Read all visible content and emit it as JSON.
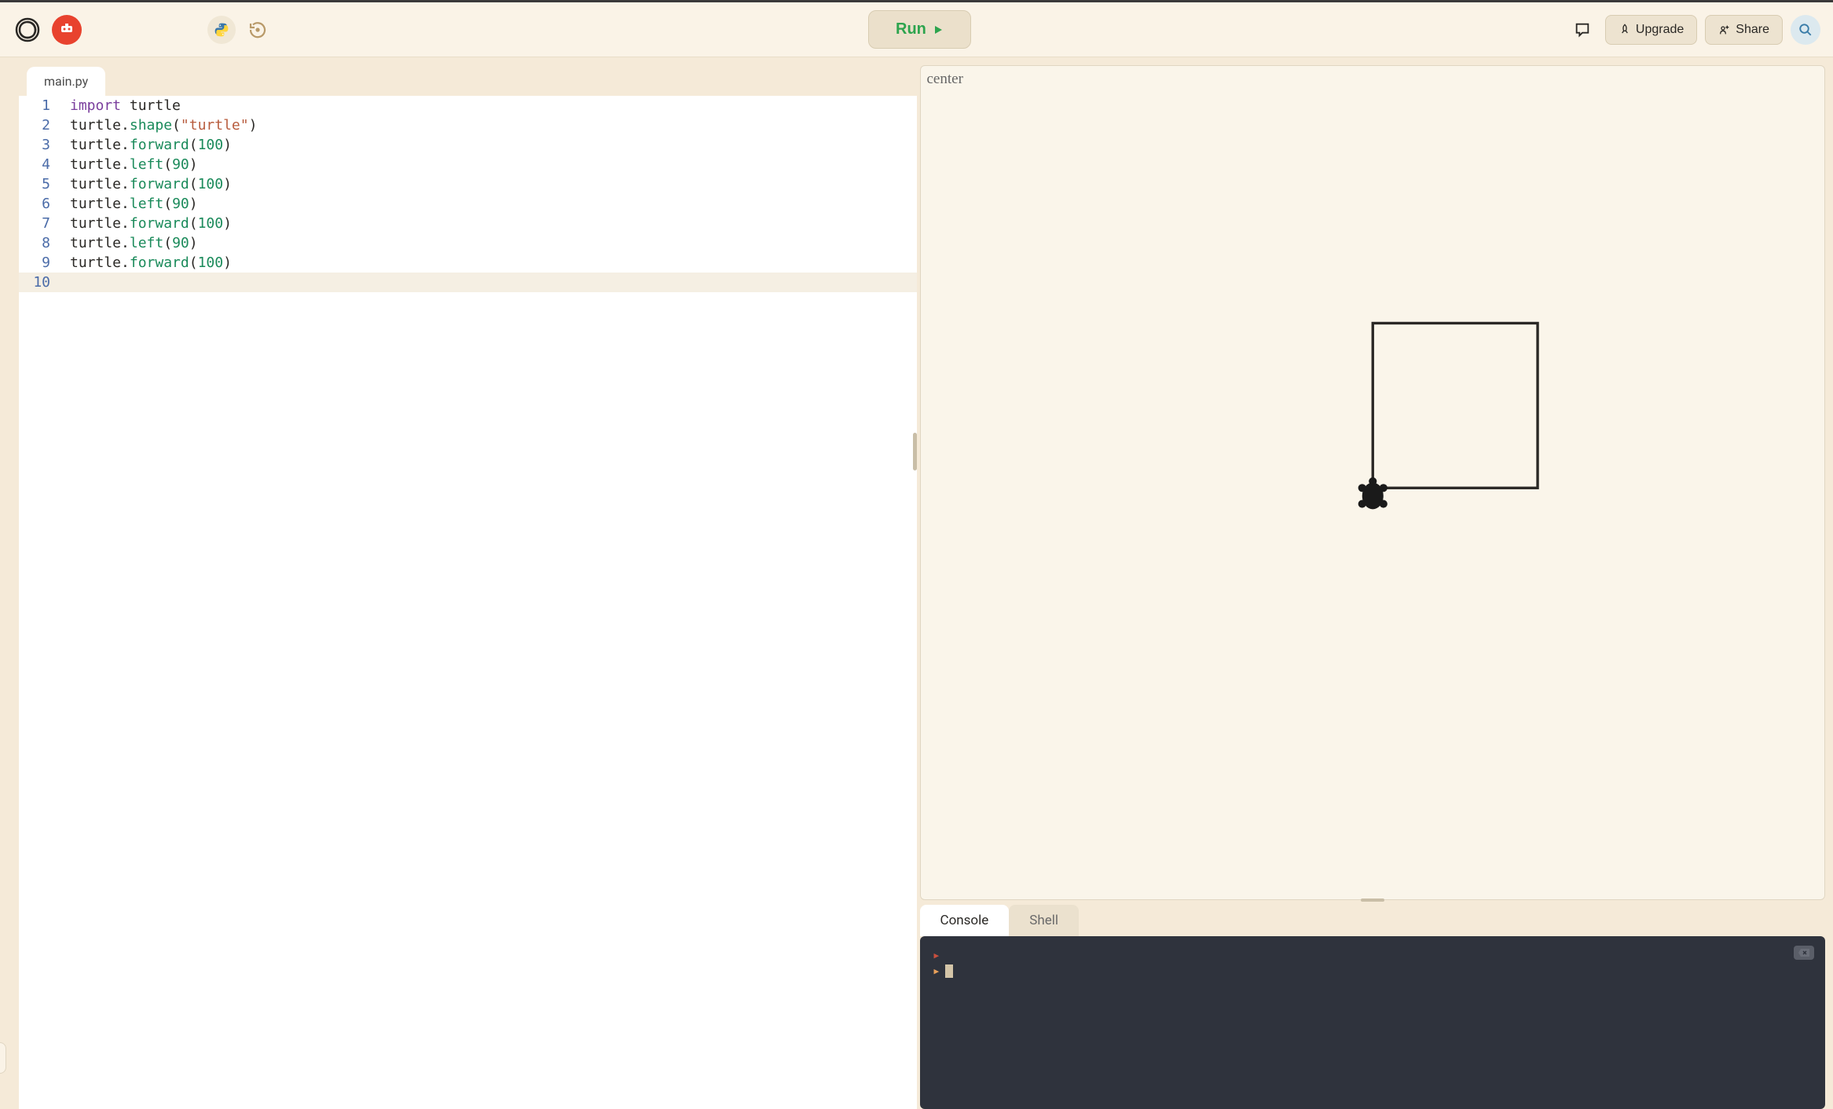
{
  "header": {
    "run_label": "Run",
    "upgrade_label": "Upgrade",
    "share_label": "Share"
  },
  "editor": {
    "tab_name": "main.py",
    "lines": [
      {
        "n": "1",
        "tokens": [
          {
            "t": "import",
            "c": "keyword"
          },
          {
            "t": " turtle",
            "c": "default"
          }
        ]
      },
      {
        "n": "2",
        "tokens": [
          {
            "t": "turtle.",
            "c": "default"
          },
          {
            "t": "shape",
            "c": "method"
          },
          {
            "t": "(",
            "c": "default"
          },
          {
            "t": "\"turtle\"",
            "c": "string"
          },
          {
            "t": ")",
            "c": "default"
          }
        ]
      },
      {
        "n": "3",
        "tokens": [
          {
            "t": "turtle.",
            "c": "default"
          },
          {
            "t": "forward",
            "c": "method"
          },
          {
            "t": "(",
            "c": "default"
          },
          {
            "t": "100",
            "c": "number"
          },
          {
            "t": ")",
            "c": "default"
          }
        ]
      },
      {
        "n": "4",
        "tokens": [
          {
            "t": "turtle.",
            "c": "default"
          },
          {
            "t": "left",
            "c": "method"
          },
          {
            "t": "(",
            "c": "default"
          },
          {
            "t": "90",
            "c": "number"
          },
          {
            "t": ")",
            "c": "default"
          }
        ]
      },
      {
        "n": "5",
        "tokens": [
          {
            "t": "turtle.",
            "c": "default"
          },
          {
            "t": "forward",
            "c": "method"
          },
          {
            "t": "(",
            "c": "default"
          },
          {
            "t": "100",
            "c": "number"
          },
          {
            "t": ")",
            "c": "default"
          }
        ]
      },
      {
        "n": "6",
        "tokens": [
          {
            "t": "turtle.",
            "c": "default"
          },
          {
            "t": "left",
            "c": "method"
          },
          {
            "t": "(",
            "c": "default"
          },
          {
            "t": "90",
            "c": "number"
          },
          {
            "t": ")",
            "c": "default"
          }
        ]
      },
      {
        "n": "7",
        "tokens": [
          {
            "t": "turtle.",
            "c": "default"
          },
          {
            "t": "forward",
            "c": "method"
          },
          {
            "t": "(",
            "c": "default"
          },
          {
            "t": "100",
            "c": "number"
          },
          {
            "t": ")",
            "c": "default"
          }
        ]
      },
      {
        "n": "8",
        "tokens": [
          {
            "t": "turtle.",
            "c": "default"
          },
          {
            "t": "left",
            "c": "method"
          },
          {
            "t": "(",
            "c": "default"
          },
          {
            "t": "90",
            "c": "number"
          },
          {
            "t": ")",
            "c": "default"
          }
        ]
      },
      {
        "n": "9",
        "tokens": [
          {
            "t": "turtle.",
            "c": "default"
          },
          {
            "t": "forward",
            "c": "method"
          },
          {
            "t": "(",
            "c": "default"
          },
          {
            "t": "100",
            "c": "number"
          },
          {
            "t": ")",
            "c": "default"
          }
        ]
      },
      {
        "n": "10",
        "tokens": [],
        "current": true
      }
    ]
  },
  "output": {
    "label": "center"
  },
  "console": {
    "tab_console": "Console",
    "tab_shell": "Shell"
  }
}
